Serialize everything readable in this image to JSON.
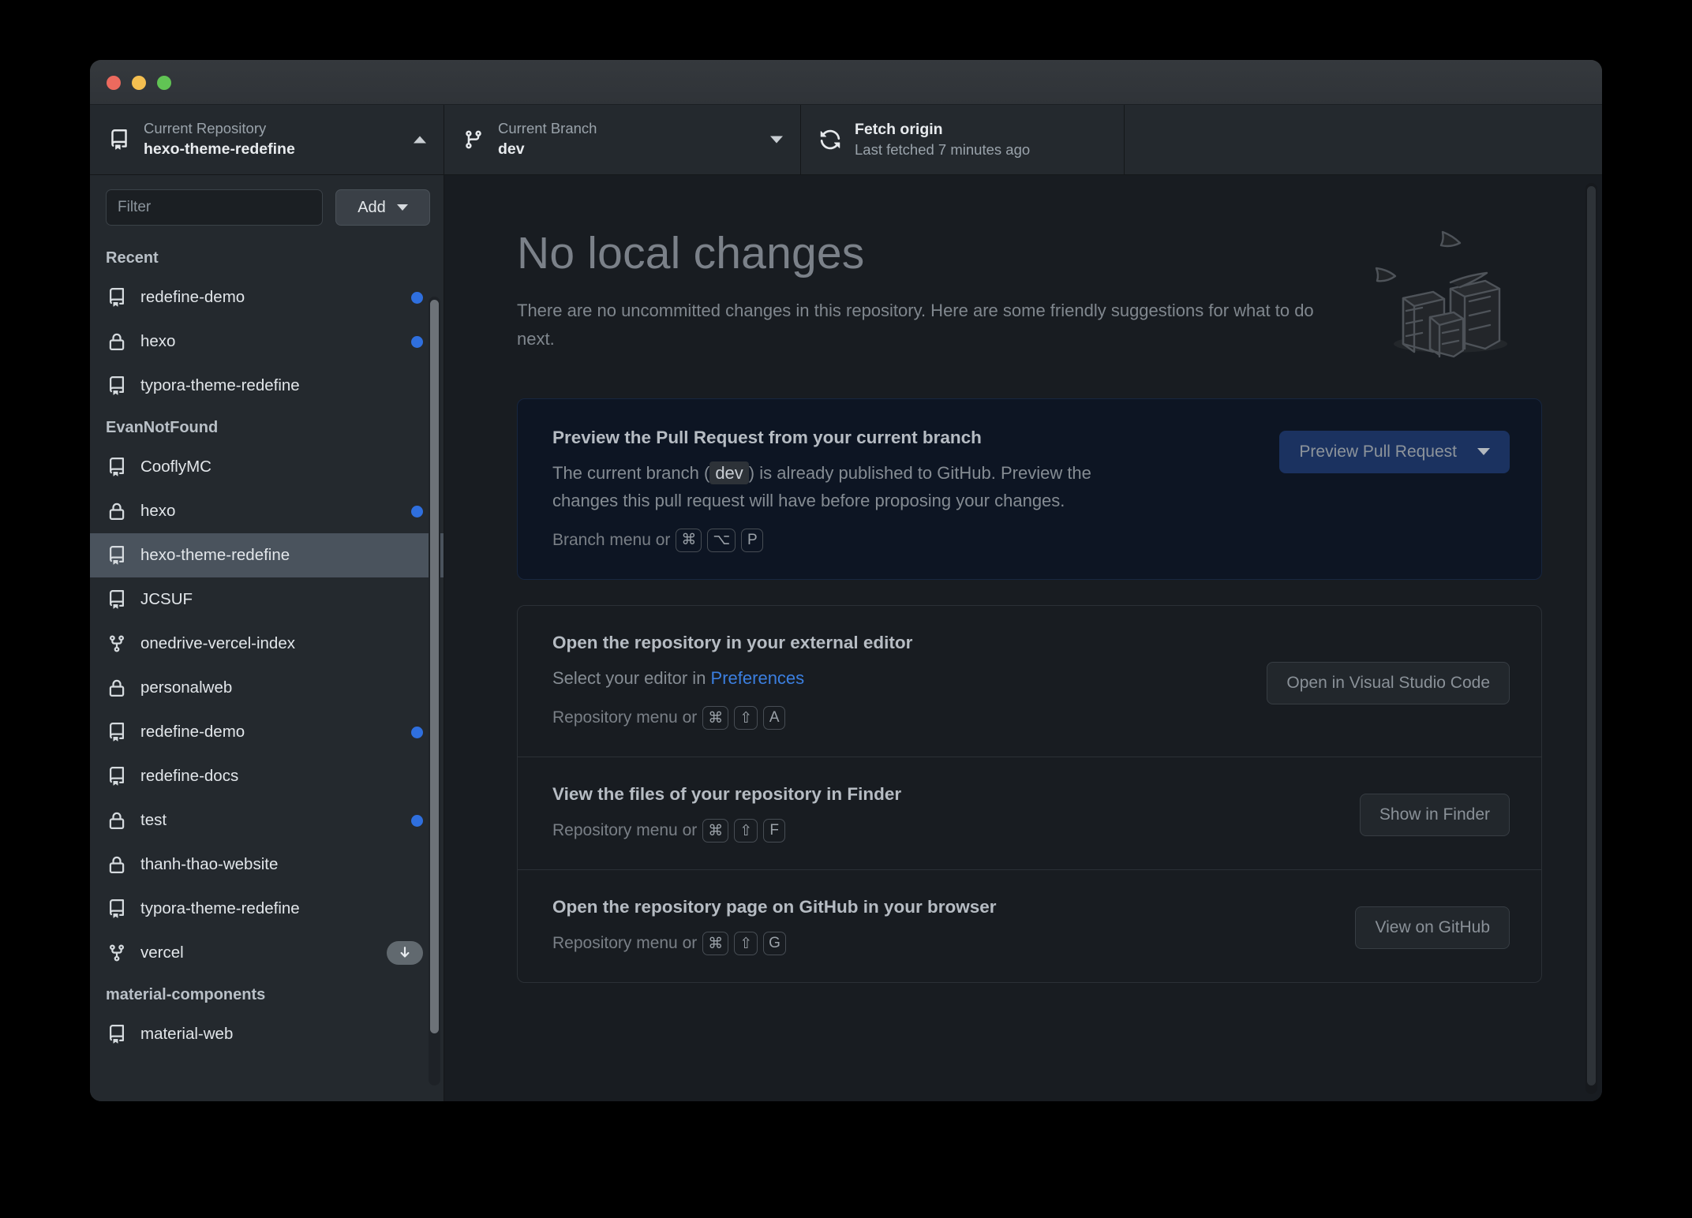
{
  "window": {
    "traffic_lights": [
      {
        "name": "close",
        "color": "#ec6a5e"
      },
      {
        "name": "minimize",
        "color": "#f4bf50"
      },
      {
        "name": "zoom",
        "color": "#61c454"
      }
    ]
  },
  "toolbar": {
    "repository": {
      "label": "Current Repository",
      "value": "hexo-theme-redefine",
      "icon": "repo-icon",
      "caret": "chevron-up-icon"
    },
    "branch": {
      "label": "Current Branch",
      "value": "dev",
      "icon": "git-branch-icon",
      "caret": "chevron-down-icon"
    },
    "fetch": {
      "label": "Fetch origin",
      "value": "Last fetched 7 minutes ago",
      "icon": "sync-icon"
    }
  },
  "sidebar": {
    "filter": {
      "placeholder": "Filter",
      "value": ""
    },
    "add_button": {
      "label": "Add"
    },
    "groups": [
      {
        "name": "Recent",
        "items": [
          {
            "name": "redefine-demo",
            "icon": "repo-icon",
            "dot": true
          },
          {
            "name": "hexo",
            "icon": "lock-icon",
            "dot": true
          },
          {
            "name": "typora-theme-redefine",
            "icon": "repo-icon",
            "dot": false
          }
        ]
      },
      {
        "name": "EvanNotFound",
        "items": [
          {
            "name": "CooflyMC",
            "icon": "repo-icon",
            "dot": false
          },
          {
            "name": "hexo",
            "icon": "lock-icon",
            "dot": true
          },
          {
            "name": "hexo-theme-redefine",
            "icon": "repo-icon",
            "dot": false,
            "selected": true
          },
          {
            "name": "JCSUF",
            "icon": "repo-icon",
            "dot": false
          },
          {
            "name": "onedrive-vercel-index",
            "icon": "fork-icon",
            "dot": false
          },
          {
            "name": "personalweb",
            "icon": "lock-icon",
            "dot": false
          },
          {
            "name": "redefine-demo",
            "icon": "repo-icon",
            "dot": true
          },
          {
            "name": "redefine-docs",
            "icon": "repo-icon",
            "dot": false
          },
          {
            "name": "test",
            "icon": "lock-icon",
            "dot": true
          },
          {
            "name": "thanh-thao-website",
            "icon": "lock-icon",
            "dot": false
          },
          {
            "name": "typora-theme-redefine",
            "icon": "repo-icon",
            "dot": false
          },
          {
            "name": "vercel",
            "icon": "fork-icon",
            "dot": false,
            "badge": "download-icon"
          }
        ]
      },
      {
        "name": "material-components",
        "items": [
          {
            "name": "material-web",
            "icon": "repo-icon",
            "dot": false
          }
        ]
      }
    ]
  },
  "main": {
    "title": "No local changes",
    "subtitle": "There are no uncommitted changes in this repository. Here are some friendly suggestions for what to do next.",
    "pr_card": {
      "title": "Preview the Pull Request from your current branch",
      "desc_before": "The current branch (",
      "branch_chip": "dev",
      "desc_after": ") is already published to GitHub. Preview the changes this pull request will have before proposing your changes.",
      "menu_label": "Branch menu or",
      "shortcut": [
        "⌘",
        "⌥",
        "P"
      ],
      "button_label": "Preview Pull Request"
    },
    "suggestions": [
      {
        "title": "Open the repository in your external editor",
        "desc_before": "Select your editor in ",
        "link": "Preferences",
        "desc_after": "",
        "menu_label": "Repository menu or",
        "shortcut": [
          "⌘",
          "⇧",
          "A"
        ],
        "button_label": "Open in Visual Studio Code"
      },
      {
        "title": "View the files of your repository in Finder",
        "desc_before": "",
        "link": "",
        "desc_after": "",
        "menu_label": "Repository menu or",
        "shortcut": [
          "⌘",
          "⇧",
          "F"
        ],
        "button_label": "Show in Finder"
      },
      {
        "title": "Open the repository page on GitHub in your browser",
        "desc_before": "",
        "link": "",
        "desc_after": "",
        "menu_label": "Repository menu or",
        "shortcut": [
          "⌘",
          "⇧",
          "G"
        ],
        "button_label": "View on GitHub"
      }
    ]
  },
  "colors": {
    "accent_blue": "#2f6fde",
    "link_blue": "#3b7fe0",
    "primary_button": "#1b3260",
    "window_chrome": "#24292e",
    "main_background": "#181c21"
  }
}
